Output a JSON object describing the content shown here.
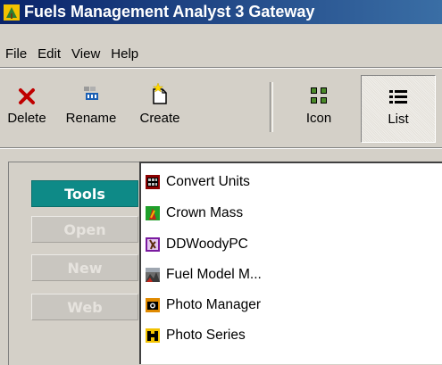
{
  "window": {
    "title": "Fuels Management Analyst 3 Gateway"
  },
  "menu": {
    "file": "File",
    "edit": "Edit",
    "view": "View",
    "help": "Help"
  },
  "toolbar": {
    "delete": "Delete",
    "rename": "Rename",
    "create": "Create",
    "icon": "Icon",
    "list": "List",
    "active_view": "List"
  },
  "sidebar": {
    "tools": "Tools",
    "open": "Open",
    "new": "New",
    "web": "Web",
    "active": "Tools",
    "active_color": "#0e8a87"
  },
  "list": {
    "items": [
      {
        "label": "Convert Units",
        "icon": "convert-units-icon"
      },
      {
        "label": "Crown Mass",
        "icon": "crown-mass-icon"
      },
      {
        "label": "DDWoodyPC",
        "icon": "ddwoodypc-icon"
      },
      {
        "label": "Fuel Model M...",
        "icon": "fuel-model-icon"
      },
      {
        "label": "Photo Manager",
        "icon": "photo-manager-icon"
      },
      {
        "label": "Photo Series",
        "icon": "photo-series-icon"
      }
    ]
  }
}
